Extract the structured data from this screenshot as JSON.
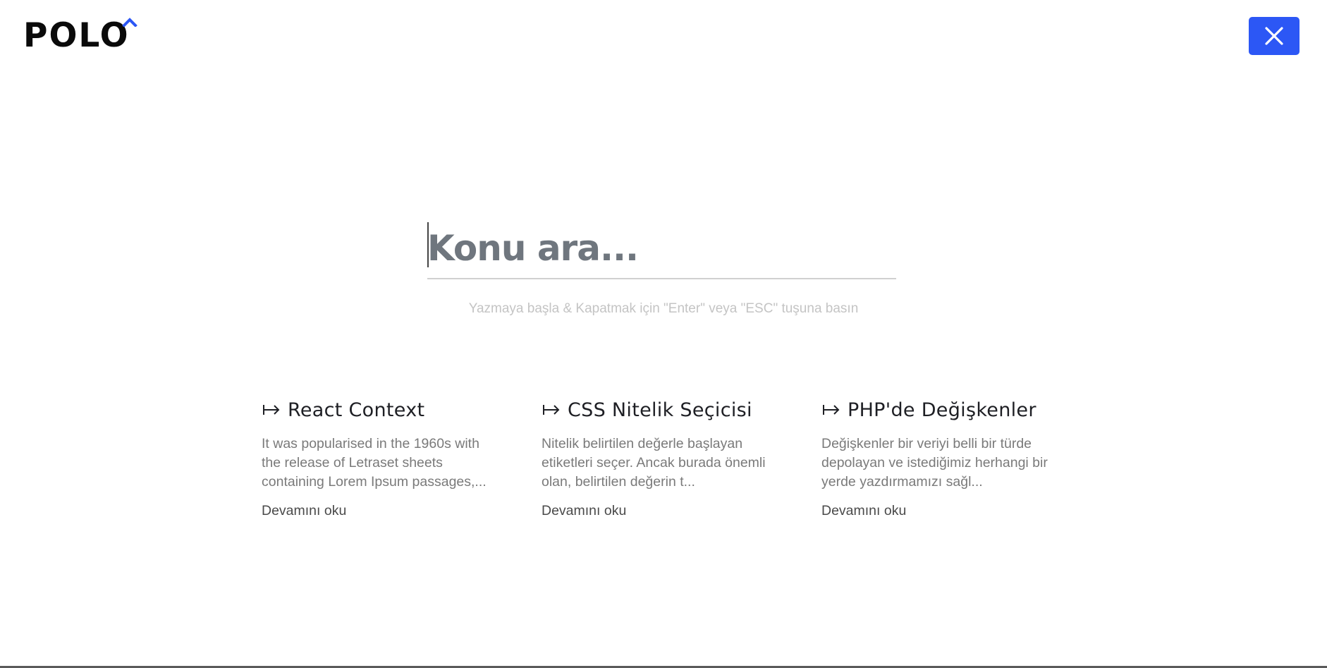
{
  "logo": {
    "text": "POLO",
    "accent_color": "#2c57f5"
  },
  "close_button": {
    "icon": "close-icon",
    "color": "#2c57f5"
  },
  "search": {
    "placeholder": "Konu ara...",
    "value": "",
    "hint": "Yazmaya başla & Kapatmak için \"Enter\" veya \"ESC\" tuşuna basın"
  },
  "results": [
    {
      "icon": "arrow-right-icon",
      "title": "React Context",
      "description": "It was popularised in the 1960s with the release of Letraset sheets containing Lorem Ipsum passages,...",
      "link": "Devamını oku"
    },
    {
      "icon": "arrow-right-icon",
      "title": "CSS Nitelik Seçicisi",
      "description": "Nitelik belirtilen değerle başlayan etiketleri seçer. Ancak burada önemli olan, belirtilen değerin t...",
      "link": "Devamını oku"
    },
    {
      "icon": "arrow-right-icon",
      "title": "PHP'de Değişkenler",
      "description": "Değişkenler bir veriyi belli bir türde depolayan ve istediğimiz herhangi bir yerde yazdırmamızı sağl...",
      "link": "Devamını oku"
    }
  ]
}
